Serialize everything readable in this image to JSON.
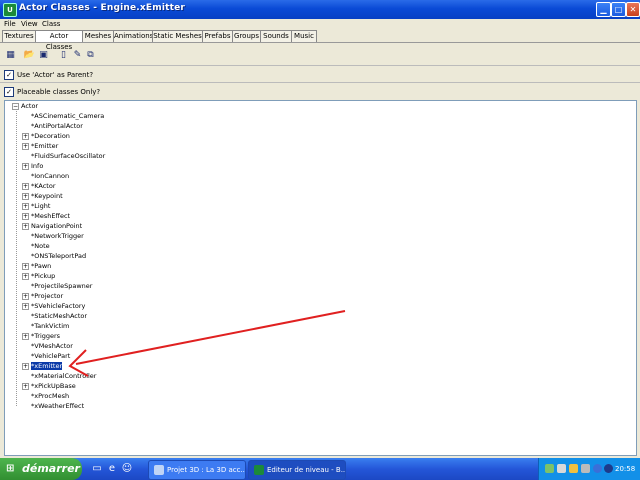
{
  "window": {
    "title": "Actor Classes - Engine.xEmitter",
    "app_icon": "unreal-u-icon",
    "buttons": [
      "minimize",
      "maximize",
      "close"
    ]
  },
  "menu": [
    "File",
    "View",
    "Class"
  ],
  "tabs": [
    {
      "label": "Textures",
      "active": false
    },
    {
      "label": "Actor Classes",
      "active": true
    },
    {
      "label": "Meshes",
      "active": false
    },
    {
      "label": "Animations",
      "active": false
    },
    {
      "label": "Static Meshes",
      "active": false
    },
    {
      "label": "Prefabs",
      "active": false
    },
    {
      "label": "Groups",
      "active": false
    },
    {
      "label": "Sounds",
      "active": false
    },
    {
      "label": "Music",
      "active": false
    }
  ],
  "toolbar": {
    "buttons": [
      "class-tree-icon",
      "open-folder-icon",
      "save-icon",
      "new-file-icon",
      "edit-pencil-icon",
      "browser-window-icon"
    ]
  },
  "options": {
    "use_actor_parent": {
      "label": "Use 'Actor' as Parent?",
      "checked": true
    },
    "placeable_only": {
      "label": "Placeable classes Only?",
      "checked": true
    }
  },
  "tree": {
    "root": {
      "label": "Actor",
      "expanded": true
    },
    "items": [
      {
        "label": "*ASCinematic_Camera",
        "expandable": false
      },
      {
        "label": "*AntiPortalActor",
        "expandable": false
      },
      {
        "label": "*Decoration",
        "expandable": true
      },
      {
        "label": "*Emitter",
        "expandable": true
      },
      {
        "label": "*FluidSurfaceOscillator",
        "expandable": false
      },
      {
        "label": "Info",
        "expandable": true
      },
      {
        "label": "*IonCannon",
        "expandable": false
      },
      {
        "label": "*KActor",
        "expandable": true
      },
      {
        "label": "*Keypoint",
        "expandable": true
      },
      {
        "label": "*Light",
        "expandable": true
      },
      {
        "label": "*MeshEffect",
        "expandable": true
      },
      {
        "label": "NavigationPoint",
        "expandable": true
      },
      {
        "label": "*NetworkTrigger",
        "expandable": false
      },
      {
        "label": "*Note",
        "expandable": false
      },
      {
        "label": "*ONSTeleportPad",
        "expandable": false
      },
      {
        "label": "*Pawn",
        "expandable": true
      },
      {
        "label": "*Pickup",
        "expandable": true
      },
      {
        "label": "*ProjectileSpawner",
        "expandable": false
      },
      {
        "label": "*Projector",
        "expandable": true
      },
      {
        "label": "*SVehicleFactory",
        "expandable": true
      },
      {
        "label": "*StaticMeshActor",
        "expandable": false
      },
      {
        "label": "*TankVictim",
        "expandable": false
      },
      {
        "label": "*Triggers",
        "expandable": true
      },
      {
        "label": "*VMeshActor",
        "expandable": false
      },
      {
        "label": "*VehiclePart",
        "expandable": false
      },
      {
        "label": "*xEmitter",
        "expandable": true,
        "selected": true
      },
      {
        "label": "*xMaterialController",
        "expandable": false
      },
      {
        "label": "*xPickUpBase",
        "expandable": true
      },
      {
        "label": "*xProcMesh",
        "expandable": false
      },
      {
        "label": "*xWeatherEffect",
        "expandable": false
      }
    ]
  },
  "annotation": {
    "color": "#e02020"
  },
  "taskbar": {
    "start_label": "démarrer",
    "quick_launch": [
      "desktop-icon",
      "ie-icon",
      "messenger-icon"
    ],
    "tasks": [
      {
        "label": "Projet 3D : La 3D acc...",
        "active": false
      },
      {
        "label": "Editeur de niveau - B...",
        "active": true
      }
    ],
    "clock": "20:58"
  },
  "colors": {
    "titlebar": "#0a4ad6",
    "selection": "#0b3aa8",
    "taskbar": "#2456d8",
    "start": "#318f31"
  }
}
